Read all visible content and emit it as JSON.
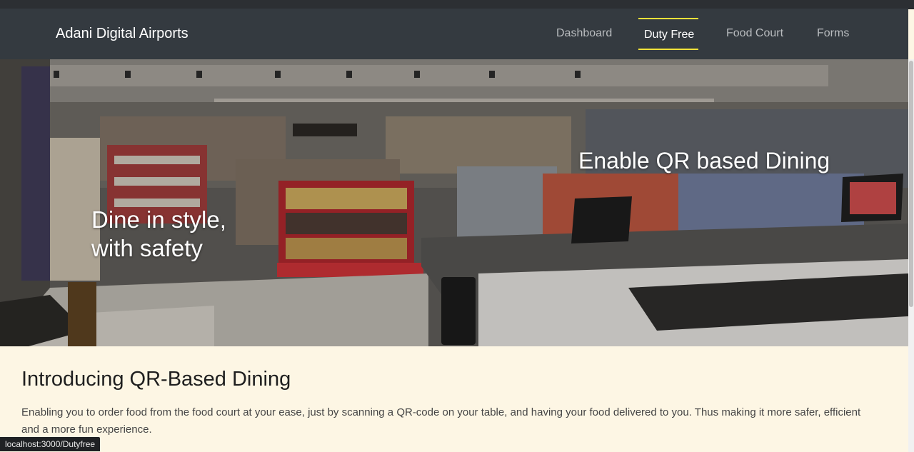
{
  "navbar": {
    "brand": "Adani Digital Airports",
    "items": [
      {
        "label": "Dashboard",
        "active": false
      },
      {
        "label": "Duty Free",
        "active": true
      },
      {
        "label": "Food Court",
        "active": false
      },
      {
        "label": "Forms",
        "active": false
      }
    ],
    "accent_color": "#f1e23a"
  },
  "hero": {
    "left_line1": "Dine in style,",
    "left_line2": "with safety",
    "right_text": "Enable QR based Dining"
  },
  "intro": {
    "heading": "Introducing QR-Based Dining",
    "body": "Enabling you to order food from the food court at your ease, just by scanning a QR-code on your table, and having your food delivered to you. Thus making it more safer, efficient and a more fun experience."
  },
  "status_bar": {
    "url": "localhost:3000/Dutyfree"
  }
}
